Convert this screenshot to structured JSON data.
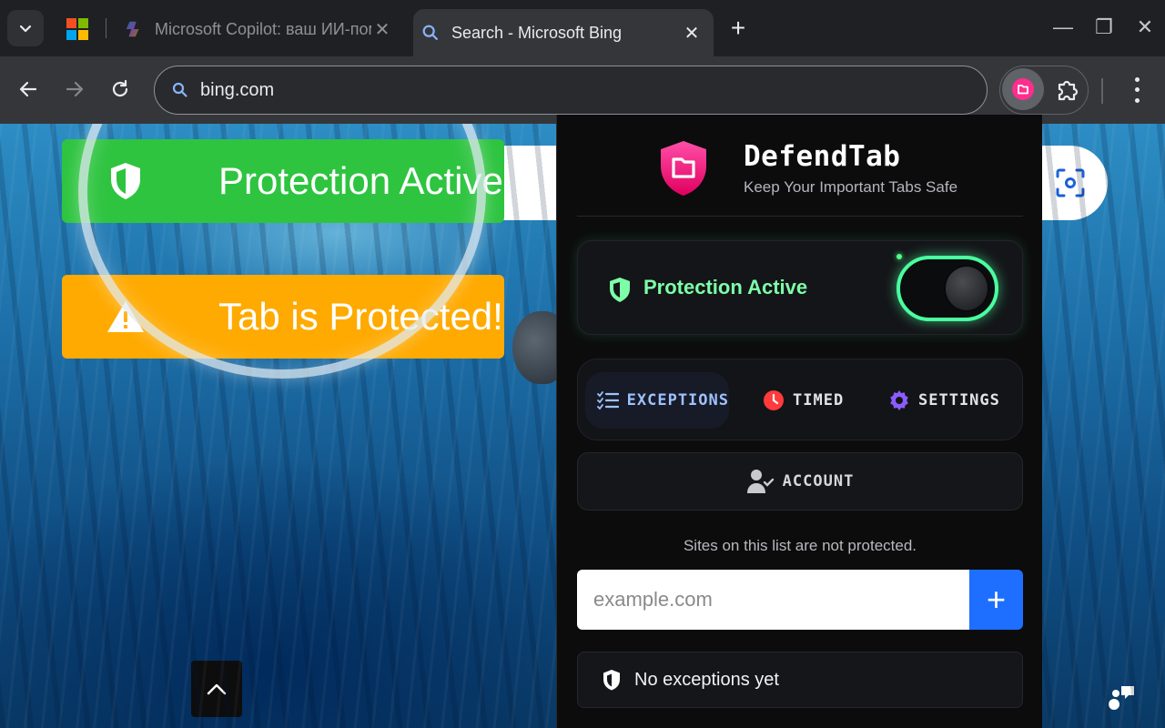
{
  "browser": {
    "tabs": [
      {
        "title": "Microsoft Copilot: ваш ИИ-пом",
        "active": false,
        "favicon": "copilot-icon"
      },
      {
        "title": "Search - Microsoft Bing",
        "active": true,
        "favicon": "search-icon"
      }
    ],
    "new_tab_label": "+",
    "window_controls": {
      "minimize": "—",
      "restore": "❐",
      "close": "✕"
    },
    "address": "bing.com",
    "colors": {
      "tabstrip": "#1f2023",
      "toolbar": "#35363a"
    }
  },
  "page": {
    "banners": [
      {
        "text": "Protection Active",
        "color": "#2ec440",
        "icon": "shield-icon"
      },
      {
        "text": "Tab is Protected!",
        "color": "#ffaa00",
        "icon": "warning-icon"
      }
    ]
  },
  "popup": {
    "brand": "DefendTab",
    "tagline": "Keep Your Important Tabs Safe",
    "status": {
      "label": "Protection Active",
      "enabled": true,
      "accent": "#7dffa8"
    },
    "nav": [
      {
        "label": "EXCEPTIONS",
        "icon": "list-check-icon",
        "active": true
      },
      {
        "label": "TIMED",
        "icon": "clock-icon",
        "active": false
      },
      {
        "label": "SETTINGS",
        "icon": "gear-icon",
        "active": false
      }
    ],
    "account_label": "ACCOUNT",
    "exceptions_hint": "Sites on this list are not protected.",
    "input_placeholder": "example.com",
    "add_label": "+",
    "empty_text": "No exceptions yet",
    "colors": {
      "brand_pink": "#ff2d8f",
      "add_button": "#1e6fff",
      "active_tab_text": "#9fc2ff"
    }
  }
}
